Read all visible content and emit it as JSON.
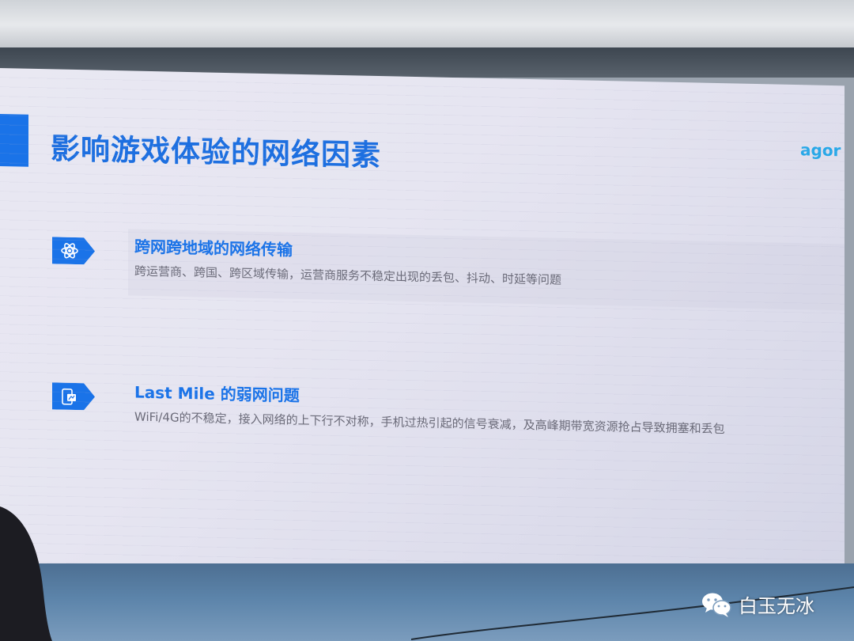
{
  "slide": {
    "title": "影响游戏体验的网络因素",
    "brand": "agor",
    "items": [
      {
        "heading": "跨网跨地域的网络传输",
        "description": "跨运营商、跨国、跨区域传输，运营商服务不稳定出现的丢包、抖动、时延等问题",
        "icon": "atom-icon"
      },
      {
        "heading": "Last Mile 的弱网问题",
        "description": "WiFi/4G的不稳定，接入网络的上下行不对称，手机过热引起的信号衰减，及高峰期带宽资源抢占导致拥塞和丢包",
        "icon": "phone-signal-icon"
      }
    ]
  },
  "watermark": {
    "text": "白玉无冰",
    "icon": "wechat-icon"
  },
  "colors": {
    "accent": "#1a73e8",
    "slide_bg": "#e6e5f1",
    "description_text": "#6a6a78"
  }
}
